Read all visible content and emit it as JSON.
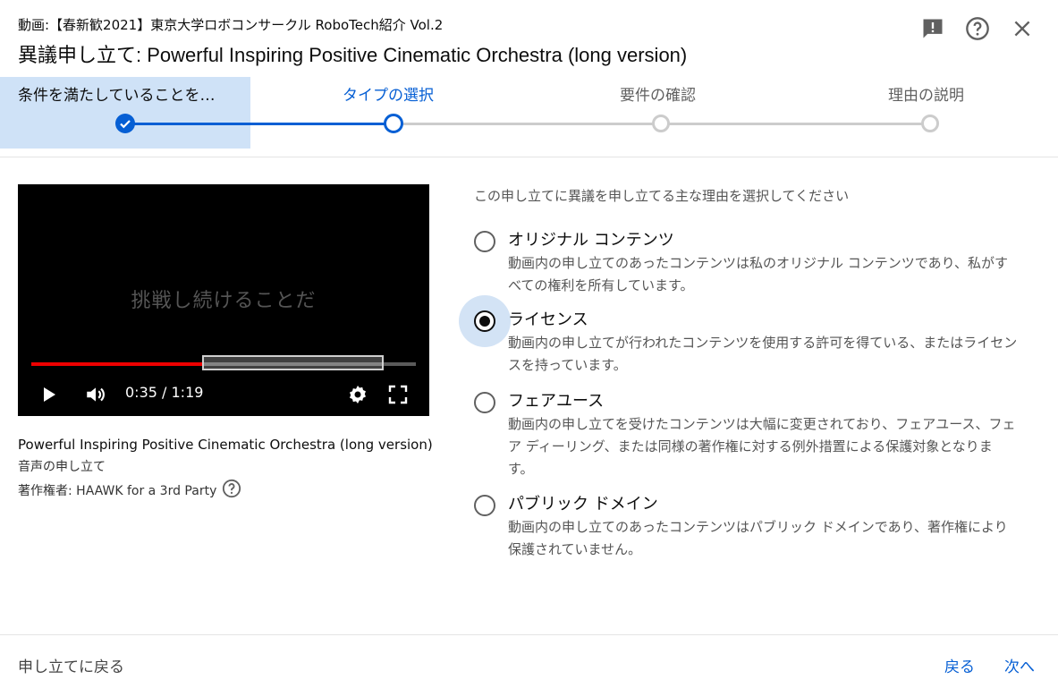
{
  "header": {
    "subtitle": "動画:【春新歓2021】東京大学ロボコンサークル RoboTech紹介 Vol.2",
    "title": "異議申し立て: Powerful Inspiring Positive Cinematic Orchestra (long version)",
    "icons": [
      "feedback-icon",
      "help-icon",
      "close-icon"
    ]
  },
  "stepper": {
    "steps": [
      {
        "label": "条件を満たしていることを…",
        "state": "done"
      },
      {
        "label": "タイプの選択",
        "state": "current"
      },
      {
        "label": "要件の確認",
        "state": "todo"
      },
      {
        "label": "理由の説明",
        "state": "todo"
      }
    ]
  },
  "video": {
    "overlay_text": "挑戦し続けることだ",
    "time": "0:35 / 1:19",
    "progress": 0.447
  },
  "media": {
    "title": "Powerful Inspiring Positive Cinematic Orchestra (long version)",
    "type": "音声の申し立て",
    "owner": "著作権者: HAAWK for a 3rd Party"
  },
  "main": {
    "prompt": "この申し立てに異議を申し立てる主な理由を選択してください",
    "options": [
      {
        "label": "オリジナル コンテンツ",
        "desc": "動画内の申し立てのあったコンテンツは私のオリジナル コンテンツであり、私がすべての権利を所有しています。",
        "selected": false
      },
      {
        "label": "ライセンス",
        "desc": "動画内の申し立てが行われたコンテンツを使用する許可を得ている、またはライセンスを持っています。",
        "selected": true
      },
      {
        "label": "フェアユース",
        "desc": "動画内の申し立てを受けたコンテンツは大幅に変更されており、フェアユース、フェア ディーリング、または同様の著作権に対する例外措置による保護対象となります。",
        "selected": false
      },
      {
        "label": "パブリック ドメイン",
        "desc": "動画内の申し立てのあったコンテンツはパブリック ドメインであり、著作権により保護されていません。",
        "selected": false
      }
    ]
  },
  "footer": {
    "back_link": "申し立てに戻る",
    "back_button": "戻る",
    "next_button": "次へ"
  },
  "colors": {
    "accent": "#065fd4",
    "done_bg": "#cfe2f7",
    "progress_red": "#ee0000"
  }
}
